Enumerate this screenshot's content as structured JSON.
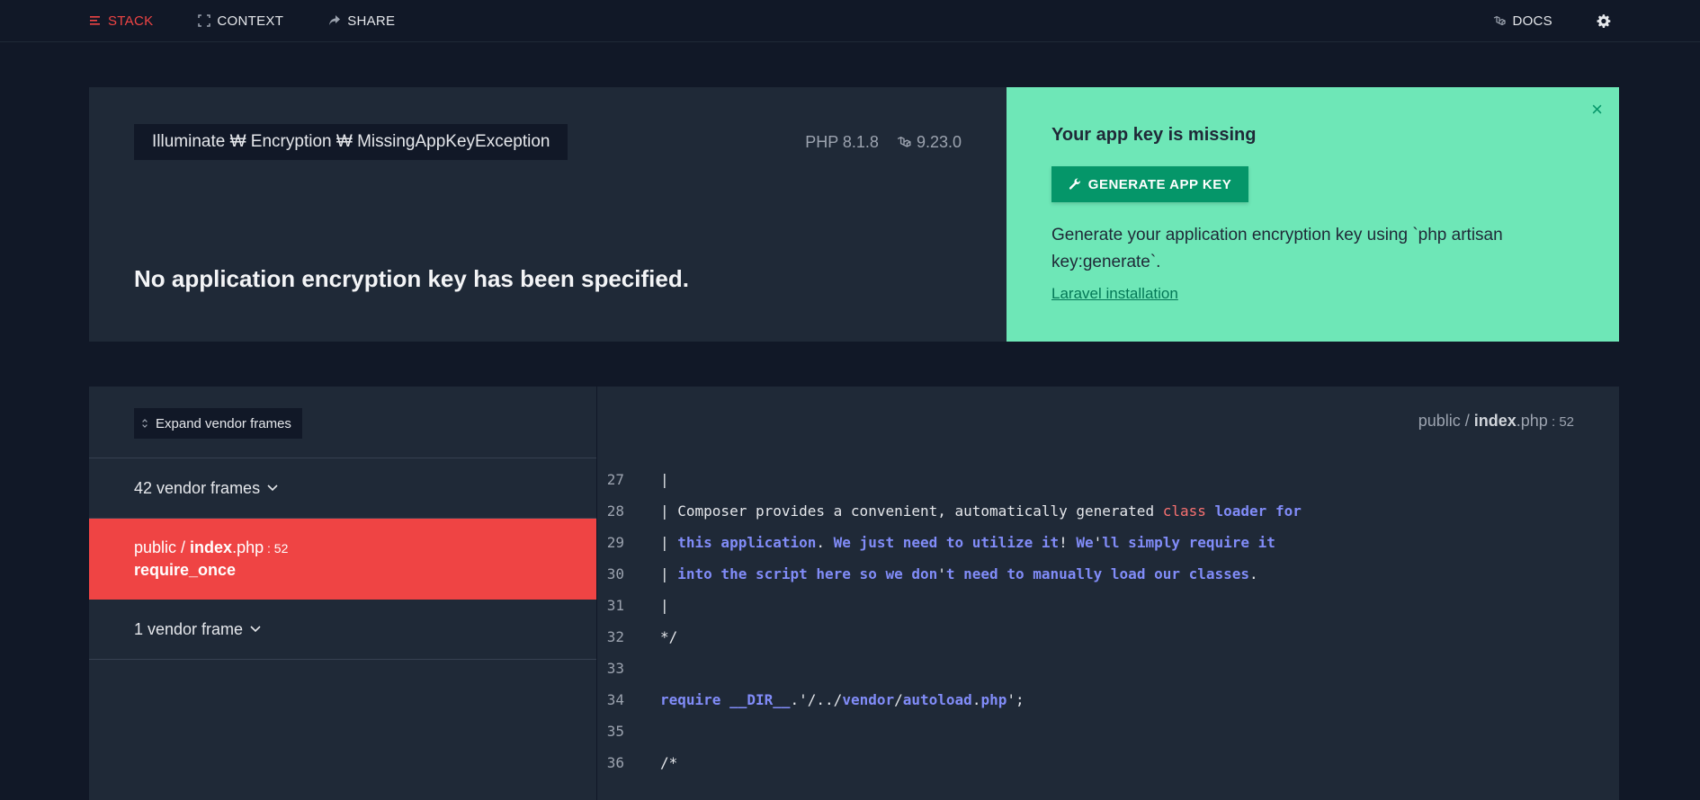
{
  "nav": {
    "stack": "STACK",
    "context": "CONTEXT",
    "share": "SHARE",
    "docs": "DOCS"
  },
  "error": {
    "exception_class": "Illuminate ₩ Encryption ₩ MissingAppKeyException",
    "php_version": "PHP 8.1.8",
    "laravel_version": "9.23.0",
    "message": "No application encryption key has been specified."
  },
  "solution": {
    "title": "Your app key is missing",
    "button": "GENERATE APP KEY",
    "description": "Generate your application encryption key using `php artisan key:generate`.",
    "link": "Laravel installation",
    "close": "×"
  },
  "frames": {
    "expand_label": "Expand vendor frames",
    "vendor_group_1": "42 vendor frames",
    "active_frame": {
      "path_prefix": "public / ",
      "file": "index",
      "ext": ".php",
      "line": " : 52",
      "function": "require_once"
    },
    "vendor_group_2": "1 vendor frame"
  },
  "code": {
    "file_prefix": "public / ",
    "file_name": "index",
    "file_ext": ".php",
    "file_line": " : 52",
    "lines": [
      {
        "no": "27",
        "segments": [
          {
            "t": "|",
            "c": "white"
          }
        ]
      },
      {
        "no": "28",
        "segments": [
          {
            "t": "| Composer provides a convenient, automatically generated ",
            "c": "white"
          },
          {
            "t": "class",
            "c": "red"
          },
          {
            "t": " loader for",
            "c": "blue"
          }
        ]
      },
      {
        "no": "29",
        "segments": [
          {
            "t": "| ",
            "c": "white"
          },
          {
            "t": "this application",
            "c": "blue"
          },
          {
            "t": ". ",
            "c": "white"
          },
          {
            "t": "We just need to utilize it",
            "c": "blue"
          },
          {
            "t": "! ",
            "c": "white"
          },
          {
            "t": "We",
            "c": "blue"
          },
          {
            "t": "'",
            "c": "white"
          },
          {
            "t": "ll simply require it",
            "c": "blue"
          }
        ]
      },
      {
        "no": "30",
        "segments": [
          {
            "t": "| ",
            "c": "white"
          },
          {
            "t": "into the script here so we don",
            "c": "blue"
          },
          {
            "t": "'",
            "c": "white"
          },
          {
            "t": "t need to manually load our classes",
            "c": "blue"
          },
          {
            "t": ".",
            "c": "white"
          }
        ]
      },
      {
        "no": "31",
        "segments": [
          {
            "t": "|",
            "c": "white"
          }
        ]
      },
      {
        "no": "32",
        "segments": [
          {
            "t": "*/",
            "c": "white"
          }
        ]
      },
      {
        "no": "33",
        "segments": []
      },
      {
        "no": "34",
        "segments": [
          {
            "t": "require",
            "c": "blue"
          },
          {
            "t": " ",
            "c": "white"
          },
          {
            "t": "__DIR__",
            "c": "blue"
          },
          {
            "t": ".'/../",
            "c": "white"
          },
          {
            "t": "vendor",
            "c": "blue"
          },
          {
            "t": "/",
            "c": "white"
          },
          {
            "t": "autoload",
            "c": "blue"
          },
          {
            "t": ".",
            "c": "white"
          },
          {
            "t": "php",
            "c": "blue"
          },
          {
            "t": "';",
            "c": "white"
          }
        ]
      },
      {
        "no": "35",
        "segments": []
      },
      {
        "no": "36",
        "segments": [
          {
            "t": "/*",
            "c": "white"
          }
        ]
      }
    ]
  },
  "colors": {
    "background": "#111827",
    "panel": "#1f2937",
    "accent_red": "#ef4444",
    "solution_green": "#6ee7b7",
    "button_green": "#059669"
  },
  "icons": [
    "stack-icon",
    "context-icon",
    "share-icon",
    "laravel-icon",
    "gear-icon",
    "wrench-icon",
    "close-icon",
    "expand-icon",
    "chevron-down-icon"
  ]
}
